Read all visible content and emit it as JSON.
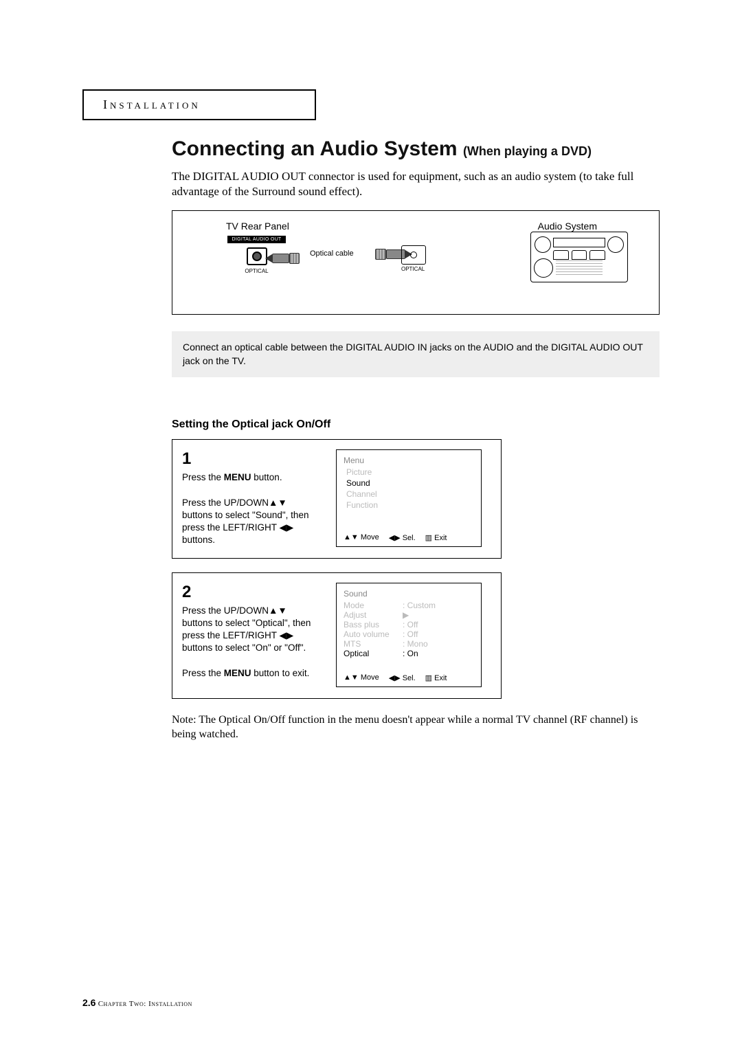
{
  "header": {
    "section": "Installation"
  },
  "title_main": "Connecting an Audio System",
  "title_sub": "(When playing a DVD)",
  "intro": "The DIGITAL AUDIO OUT connector is used for equipment, such as an audio system (to take full advantage of the Surround sound effect).",
  "diagram": {
    "tv_panel_label": "TV Rear Panel",
    "audio_system_label": "Audio System",
    "optical_cable_label": "Optical cable",
    "digital_audio_out": "DIGITAL AUDIO OUT",
    "optical": "OPTICAL"
  },
  "connect_instruction": "Connect an optical cable between the DIGITAL AUDIO IN jacks on the AUDIO and the DIGITAL AUDIO OUT jack on the TV.",
  "subheading": "Setting the Optical jack On/Off",
  "step1": {
    "num": "1",
    "line1_a": "Press the ",
    "line1_b": "MENU",
    "line1_c": " button.",
    "line2": "Press the UP/DOWN▲▼ buttons to select \"Sound\", then press the LEFT/RIGHT ◀▶ buttons.",
    "osd": {
      "title": "Menu",
      "items": [
        "Picture",
        "Sound",
        "Channel",
        "Function"
      ],
      "selected": "Sound",
      "foot_move": "▲▼ Move",
      "foot_sel": "◀▶ Sel.",
      "foot_exit_icon": "▥",
      "foot_exit": " Exit"
    }
  },
  "step2": {
    "num": "2",
    "line1": "Press the UP/DOWN▲▼ buttons to select \"Optical\", then press the LEFT/RIGHT ◀▶ buttons to select \"On\" or \"Off\".",
    "line2_a": "Press the ",
    "line2_b": "MENU",
    "line2_c": " button to exit.",
    "osd": {
      "title": "Sound",
      "rows": [
        {
          "k": "Mode",
          "v": ": Custom"
        },
        {
          "k": "Adjust",
          "v": "▶"
        },
        {
          "k": "Bass plus",
          "v": ": Off"
        },
        {
          "k": "Auto volume",
          "v": ": Off"
        },
        {
          "k": "MTS",
          "v": ": Mono"
        },
        {
          "k": "Optical",
          "v": ": On",
          "sel": true
        }
      ],
      "foot_move": "▲▼ Move",
      "foot_sel": "◀▶ Sel.",
      "foot_exit_icon": "▥",
      "foot_exit": " Exit"
    }
  },
  "note": "Note: The Optical On/Off function in the menu doesn't appear while a normal TV channel (RF channel) is being watched.",
  "footer": {
    "page_num": "2.6",
    "chapter": " Chapter Two: Installation"
  }
}
